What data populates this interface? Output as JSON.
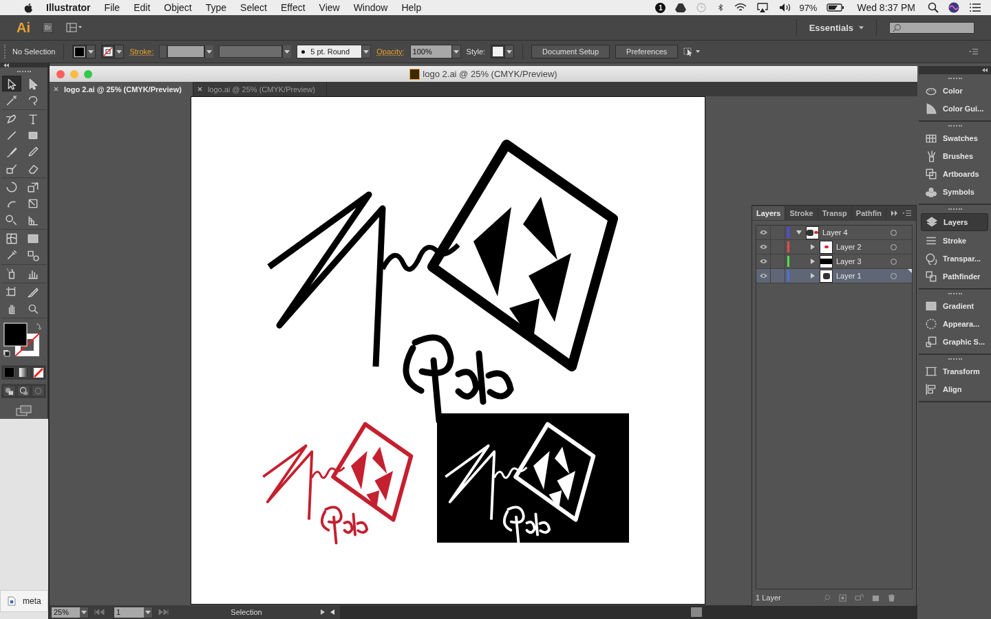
{
  "menu_bar": {
    "app": "Illustrator",
    "menus": [
      "File",
      "Edit",
      "Object",
      "Type",
      "Select",
      "Effect",
      "View",
      "Window",
      "Help"
    ],
    "notification_badge": "1",
    "battery": "97%",
    "clock": "Wed 8:37 PM"
  },
  "app_bar": {
    "logo": "Ai",
    "bridge": "Br",
    "workspace": "Essentials"
  },
  "control_bar": {
    "selection": "No Selection",
    "stroke_label": "Stroke:",
    "brush": "5 pt. Round",
    "opacity_label": "Opacity:",
    "opacity": "100%",
    "style_label": "Style:",
    "buttons": [
      "Document Setup",
      "Preferences"
    ]
  },
  "tools": [
    [
      {
        "kind": "selection",
        "selected": true
      },
      {
        "kind": "direct",
        "selected": false
      },
      {
        "kind": "wand",
        "selected": false
      },
      {
        "kind": "lasso",
        "selected": false
      }
    ],
    [
      {
        "kind": "pen",
        "selected": false
      },
      {
        "kind": "type",
        "selected": false
      },
      {
        "kind": "line",
        "selected": false
      },
      {
        "kind": "rectangle",
        "selected": false
      },
      {
        "kind": "paintbrush",
        "selected": false
      },
      {
        "kind": "pencil",
        "selected": false
      },
      {
        "kind": "shaper",
        "selected": false
      },
      {
        "kind": "eraser",
        "selected": false
      }
    ],
    [
      {
        "kind": "rotate",
        "selected": false
      },
      {
        "kind": "scale",
        "selected": false
      },
      {
        "kind": "warp",
        "selected": false
      },
      {
        "kind": "free-transform",
        "selected": false
      },
      {
        "kind": "shape-builder",
        "selected": false
      },
      {
        "kind": "perspective",
        "selected": false
      }
    ],
    [
      {
        "kind": "mesh",
        "selected": false
      },
      {
        "kind": "gradient",
        "selected": false
      },
      {
        "kind": "eyedropper",
        "selected": false
      },
      {
        "kind": "blend",
        "selected": false
      }
    ],
    [
      {
        "kind": "sprayer",
        "selected": false
      },
      {
        "kind": "graph",
        "selected": false
      }
    ],
    [
      {
        "kind": "artboard",
        "selected": false
      },
      {
        "kind": "slice",
        "selected": false
      },
      {
        "kind": "hand",
        "selected": false
      },
      {
        "kind": "zoom",
        "selected": false
      }
    ]
  ],
  "document": {
    "title": "logo 2.ai @ 25% (CMYK/Preview)",
    "tabs": [
      {
        "label": "logo 2.ai @ 25% (CMYK/Preview)",
        "selected": true
      },
      {
        "label": "logo.ai @ 25% (CMYK/Preview)",
        "selected": false
      }
    ],
    "status": {
      "zoom": "25%",
      "artboard": "1",
      "tool": "Selection"
    }
  },
  "layers_panel": {
    "tabs": [
      {
        "label": "Layers",
        "selected": true
      },
      {
        "label": "Stroke",
        "selected": false
      },
      {
        "label": "Transp",
        "selected": false
      },
      {
        "label": "Pathfin",
        "selected": false
      }
    ],
    "layers": [
      {
        "name": "Layer 4",
        "color": "#4b4bf0",
        "kind": "mixed",
        "visible": true,
        "expanded": true,
        "selected": false,
        "children": [
          {
            "name": "Layer 2",
            "color": "#f04848",
            "kind": "red-art",
            "visible": true,
            "expanded": false,
            "selected": false
          },
          {
            "name": "Layer 3",
            "color": "#4ce04c",
            "kind": "black-band",
            "visible": true,
            "expanded": false,
            "selected": false
          },
          {
            "name": "Layer 1",
            "color": "#4b6ef0",
            "kind": "black-art",
            "visible": true,
            "expanded": false,
            "selected": true
          }
        ]
      }
    ],
    "footer": "1 Layer"
  },
  "dock": [
    [
      {
        "label": "Color",
        "kind": "palette",
        "selected": false
      },
      {
        "label": "Color Gui...",
        "kind": "wedge",
        "selected": false
      }
    ],
    [
      {
        "label": "Swatches",
        "kind": "swatches",
        "selected": false
      },
      {
        "label": "Brushes",
        "kind": "brushes",
        "selected": false
      },
      {
        "label": "Artboards",
        "kind": "artboards",
        "selected": false
      },
      {
        "label": "Symbols",
        "kind": "symbols",
        "selected": false
      }
    ],
    [
      {
        "label": "Layers",
        "kind": "layers",
        "selected": true
      },
      {
        "label": "Stroke",
        "kind": "stroke",
        "selected": false
      },
      {
        "label": "Transpar...",
        "kind": "transparency",
        "selected": false
      },
      {
        "label": "Pathfinder",
        "kind": "pathfinder",
        "selected": false
      }
    ],
    [
      {
        "label": "Gradient",
        "kind": "gradient",
        "selected": false
      },
      {
        "label": "Appeara...",
        "kind": "appearance",
        "selected": false
      },
      {
        "label": "Graphic S...",
        "kind": "graphic-styles",
        "selected": false
      }
    ],
    [
      {
        "label": "Transform",
        "kind": "transform",
        "selected": false
      },
      {
        "label": "Align",
        "kind": "align",
        "selected": false
      }
    ]
  ],
  "desktop_file": "meta"
}
